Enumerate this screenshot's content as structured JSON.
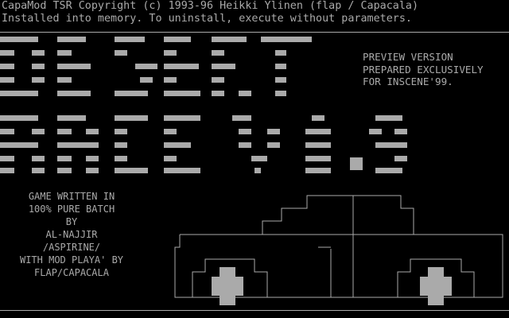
{
  "terminal": {
    "line1": "CapaMod TSR Copyright (c) 1993-96 Heikki Ylinen (flap / Capacala)",
    "line2": "Installed into memory. To uninstall, execute without parameters."
  },
  "logo": {
    "text": "DESERT RACE V0.9"
  },
  "preview": {
    "lines": [
      "PREVIEW VERSION",
      "PREPARED EXCLUSIVELY",
      "FOR INSCENE'99."
    ]
  },
  "credits": {
    "lines": [
      "GAME WRITTEN IN",
      "100% PURE BATCH",
      "BY",
      "AL-NAJJIR",
      "/ASPIRINE/",
      "WITH MOD PLAYA' BY",
      "FLAP/CAPACALA"
    ]
  },
  "colors": {
    "background": "#000000",
    "text": "#aaaaaa",
    "block": "#aaaaaa"
  },
  "car": {
    "icon": "car-icon"
  }
}
